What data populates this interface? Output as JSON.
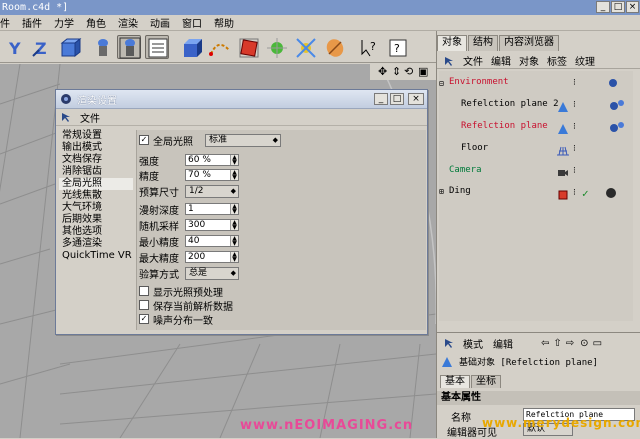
{
  "window": {
    "title": "Room.c4d *]",
    "min": "_",
    "max": "□",
    "close": "×"
  },
  "menubar": [
    "件",
    "插件",
    "力学",
    "角色",
    "渲染",
    "动画",
    "窗口",
    "帮助"
  ],
  "dialog": {
    "title": "渲染设置",
    "menu": "文件",
    "controls": [
      "_",
      "□",
      "×"
    ],
    "categories": [
      "常规设置",
      "输出模式",
      "文档保存",
      "消除锯齿",
      "全局光照",
      "光线焦散",
      "大气环境",
      "后期效果",
      "其他选项",
      "多通渲染",
      "QuickTime VR"
    ],
    "selected_category": "全局光照",
    "gi_checkbox": {
      "label": "全局光照",
      "checked": true,
      "mode": "标准"
    },
    "fields": [
      {
        "label": "强度",
        "value": "60 %"
      },
      {
        "label": "精度",
        "value": "70 %"
      },
      {
        "label": "预算尺寸",
        "value": "1/2"
      },
      {
        "label": "漫射深度",
        "value": "1"
      },
      {
        "label": "随机采样",
        "value": "300"
      },
      {
        "label": "最小精度",
        "value": "40"
      },
      {
        "label": "最大精度",
        "value": "200"
      },
      {
        "label": "验算方式",
        "value": "总是"
      }
    ],
    "options": [
      {
        "label": "显示光照预处理",
        "checked": false
      },
      {
        "label": "保存当前解析数据",
        "checked": false
      },
      {
        "label": "噪声分布一致",
        "checked": true
      }
    ]
  },
  "right": {
    "tabs": [
      "对象",
      "结构",
      "内容浏览器"
    ],
    "menu": [
      "文件",
      "编辑",
      "对象",
      "标签",
      "纹理"
    ],
    "objects": [
      {
        "name": "Environment",
        "color": "#c8102e"
      },
      {
        "name": "Refelction plane 2",
        "color": "#000000"
      },
      {
        "name": "Refelction plane",
        "color": "#c8102e"
      },
      {
        "name": "Floor",
        "color": "#000000"
      },
      {
        "name": "Camera",
        "color": "#007a3a"
      },
      {
        "name": "Ding",
        "color": "#000000"
      }
    ],
    "attr_menu": [
      "模式",
      "编辑"
    ],
    "attr_title": "基础对象 [Refelction plane]",
    "attr_tabs": [
      "基本",
      "坐标"
    ],
    "section": "基本属性",
    "name_label": "名称",
    "name_value": "Refelction plane",
    "editor_label": "编辑器可见",
    "editor_value": "默认"
  },
  "watermarks": [
    "www.nEOIMAGING.cn",
    "www.merydesign.com"
  ],
  "colors": {
    "accent": "#7a96c8",
    "red": "#c8102e",
    "green": "#007a3a"
  }
}
